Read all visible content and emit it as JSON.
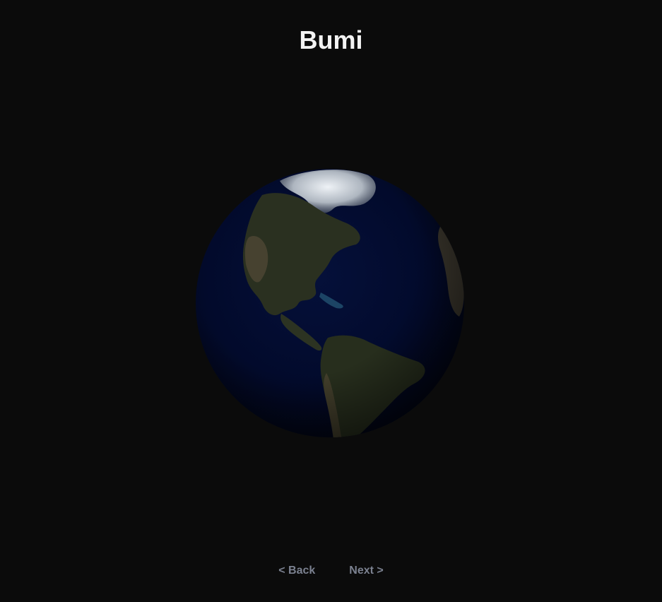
{
  "page": {
    "title": "Bumi"
  },
  "globe": {
    "icon": "earth-globe-icon",
    "ocean_color": "#020a2b",
    "land_color": "#2a3020",
    "ice_color": "#dfe6ee"
  },
  "nav": {
    "back_label": "< Back",
    "next_label": "Next >",
    "color": "#7b8190"
  }
}
